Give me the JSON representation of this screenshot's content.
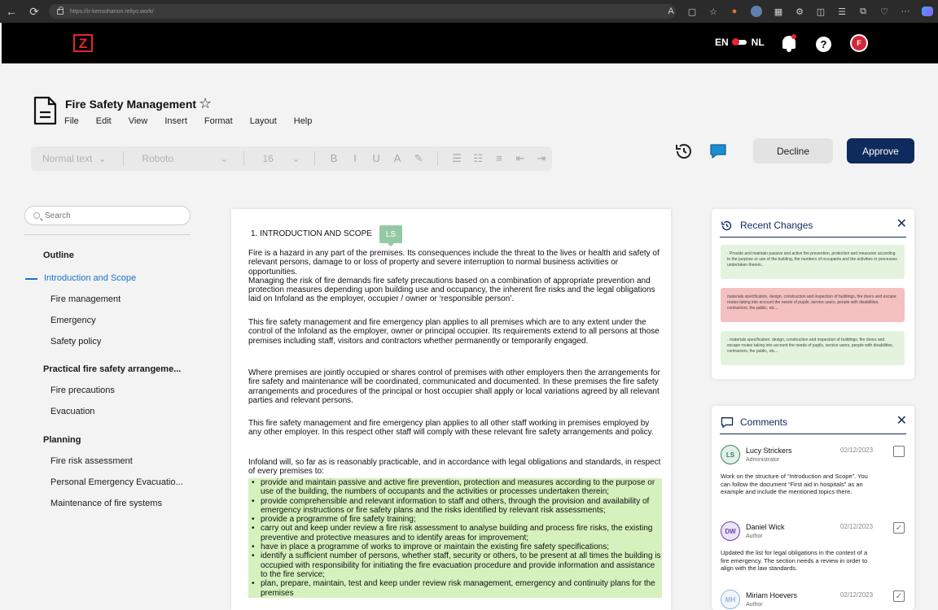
{
  "browser": {
    "url": "https://ir-kensohanon.reliyo.work/",
    "icons": [
      "back-icon",
      "refresh-icon",
      "read-aloud-icon",
      "split-icon",
      "favorite-icon",
      "extension-icon",
      "profile-icon",
      "cloud-icon",
      "settings-icon",
      "split-screen-icon",
      "favorites-icon",
      "collections-icon",
      "performance-icon",
      "more-icon",
      "copilot-icon"
    ]
  },
  "header": {
    "logo": "Z",
    "lang_left": "EN",
    "lang_right": "NL",
    "help": "?",
    "user_initial": "F",
    "colors": {
      "brand_red": "#e3262f",
      "navy": "#0f2a5c"
    }
  },
  "document": {
    "title": "Fire Safety Management",
    "menu": [
      "File",
      "Edit",
      "View",
      "Insert",
      "Format",
      "Layout",
      "Help"
    ]
  },
  "toolbar": {
    "style": "Normal text",
    "font": "Roboto",
    "size": "16",
    "format_buttons": [
      {
        "label": "B",
        "name": "bold"
      },
      {
        "label": "I",
        "name": "italic"
      },
      {
        "label": "U",
        "name": "underline"
      },
      {
        "label": "A",
        "name": "text-color"
      },
      {
        "label": "✎",
        "name": "highlight"
      }
    ],
    "list_buttons": [
      {
        "label": "☰",
        "name": "bullet-list"
      },
      {
        "label": "☷",
        "name": "numbered-list"
      },
      {
        "label": "≡",
        "name": "align"
      },
      {
        "label": "⇤",
        "name": "outdent"
      },
      {
        "label": "⇥",
        "name": "indent"
      }
    ]
  },
  "actions": {
    "decline": "Decline",
    "approve": "Approve"
  },
  "outline": {
    "search_placeholder": "Search",
    "title": "Outline",
    "items": [
      {
        "label": "Introduction and Scope",
        "level": 1,
        "active": true
      },
      {
        "label": "Fire management",
        "level": 2
      },
      {
        "label": "Emergency",
        "level": 2
      },
      {
        "label": "Safety policy",
        "level": 2
      },
      {
        "label": "Practical fire safety arrangeme...",
        "level": 1
      },
      {
        "label": "Fire precautions",
        "level": 2
      },
      {
        "label": "Evacuation",
        "level": 2
      },
      {
        "label": "Planning",
        "level": 1
      },
      {
        "label": "Fire risk assessment",
        "level": 2
      },
      {
        "label": "Personal Emergency Evacuatio...",
        "level": 2
      },
      {
        "label": "Maintenance of fire systems",
        "level": 2
      }
    ]
  },
  "page": {
    "heading": "1.  INTRODUCTION AND SCOPE",
    "badge": "LS",
    "p1": "Fire is a hazard in any part of the premises. Its consequences include the threat to the lives or health and safety of relevant persons, damage to or loss of property and severe interruption to normal business activities or opportunities.",
    "p1b": "Managing the risk of fire demands fire safety precautions based on a combination of appropriate prevention and protection measures depending upon building use and occupancy, the inherent fire risks and the legal obligations laid on Infoland as the employer, occupier / owner or ‘responsible person’.",
    "p2": "This fire safety management and fire emergency plan applies to all premises which are to any extent under the control of the Infoland as the employer, owner or principal occupier. Its requirements extend to all persons at those premises including staff, visitors and contractors whether permanently or temporarily engaged.",
    "p3": "Where premises are jointly occupied or shares control of premises with other employers then the arrangements for fire safety and maintenance will be coordinated, communicated and documented. In these premises the fire safety arrangements and procedures of the principal or host occupier shall apply or local variations agreed by all relevant parties and relevant persons.",
    "p4": "This fire safety management and fire emergency plan applies to all other staff working in premises employed by any other employer. In this respect other staff will comply with these relevant fire safety arrangements and policy.",
    "p5": "Infoland will, so far as is reasonably practicable, and in accordance with legal obligations and standards, in respect of every premises to:",
    "bullets": [
      "provide and maintain passive and active fire prevention, protection and measures according to the purpose or use of the building, the numbers of occupants and the activities or processes undertaken therein;",
      "provide comprehensible and relevant information to staff and others, through the provision and availability of emergency instructions or fire safety plans and the risks identified by relevant risk assessments;",
      "provide a programme of fire safety training;",
      "carry out and keep under review a fire risk assessment to analyse building and process fire risks, the existing preventive and protective measures and to identify areas for improvement;",
      "have in place a programme of works to improve or maintain the existing fire safety specifications;",
      "identify a sufficient number of persons, whether staff, security or others, to be present at all times the building is occupied with responsibility for initiating the fire evacuation procedure and provide information and assistance to the fire service;",
      "plan, prepare, maintain, test and keep under review risk management, emergency and continuity plans for the premises"
    ]
  },
  "recent_changes": {
    "title": "Recent Changes",
    "items": [
      {
        "text": "· Provide and maintain passive and active fire prevention, protection and measures according to the purpose or use of the building, the numbers of occupants and the activities or processes undertaken therein..",
        "type": "add"
      },
      {
        "text": "materials specification, design, construction and inspection of buildings, fire doors and escape routes taking into account the needs of pupils, service users, people with disabilities, contractors, the public, etc...",
        "type": "del"
      },
      {
        "text": "· materials specification, design, construction and inspection of buildings, fire doors and escape routes taking into account the needs of pupils, service users, people with disabilities, contractors, the public, etc...",
        "type": "add"
      }
    ]
  },
  "comments": {
    "title": "Comments",
    "items": [
      {
        "initials": "LS",
        "name": "Lucy Strickers",
        "role": "Administrator",
        "date": "02/12/2023",
        "checked": false,
        "text": "Work on the structure of “Introduction and Scope”. You can follow the document “First aid in hospitals” as an example and include the mentioned topics there.",
        "color": "#2e8b57"
      },
      {
        "initials": "DW",
        "name": "Daniel Wick",
        "role": "Author",
        "date": "02/12/2023",
        "checked": true,
        "text": "Updated the list for legal obligations in the context of a fire emergency. The section needs a review in order to align with the law standards.",
        "color": "#6a3fb0"
      },
      {
        "initials": "MH",
        "name": "Miriam Hoevers",
        "role": "Author",
        "date": "02/12/2023",
        "checked": true,
        "text": "",
        "color": "#8fb4e4"
      }
    ]
  }
}
